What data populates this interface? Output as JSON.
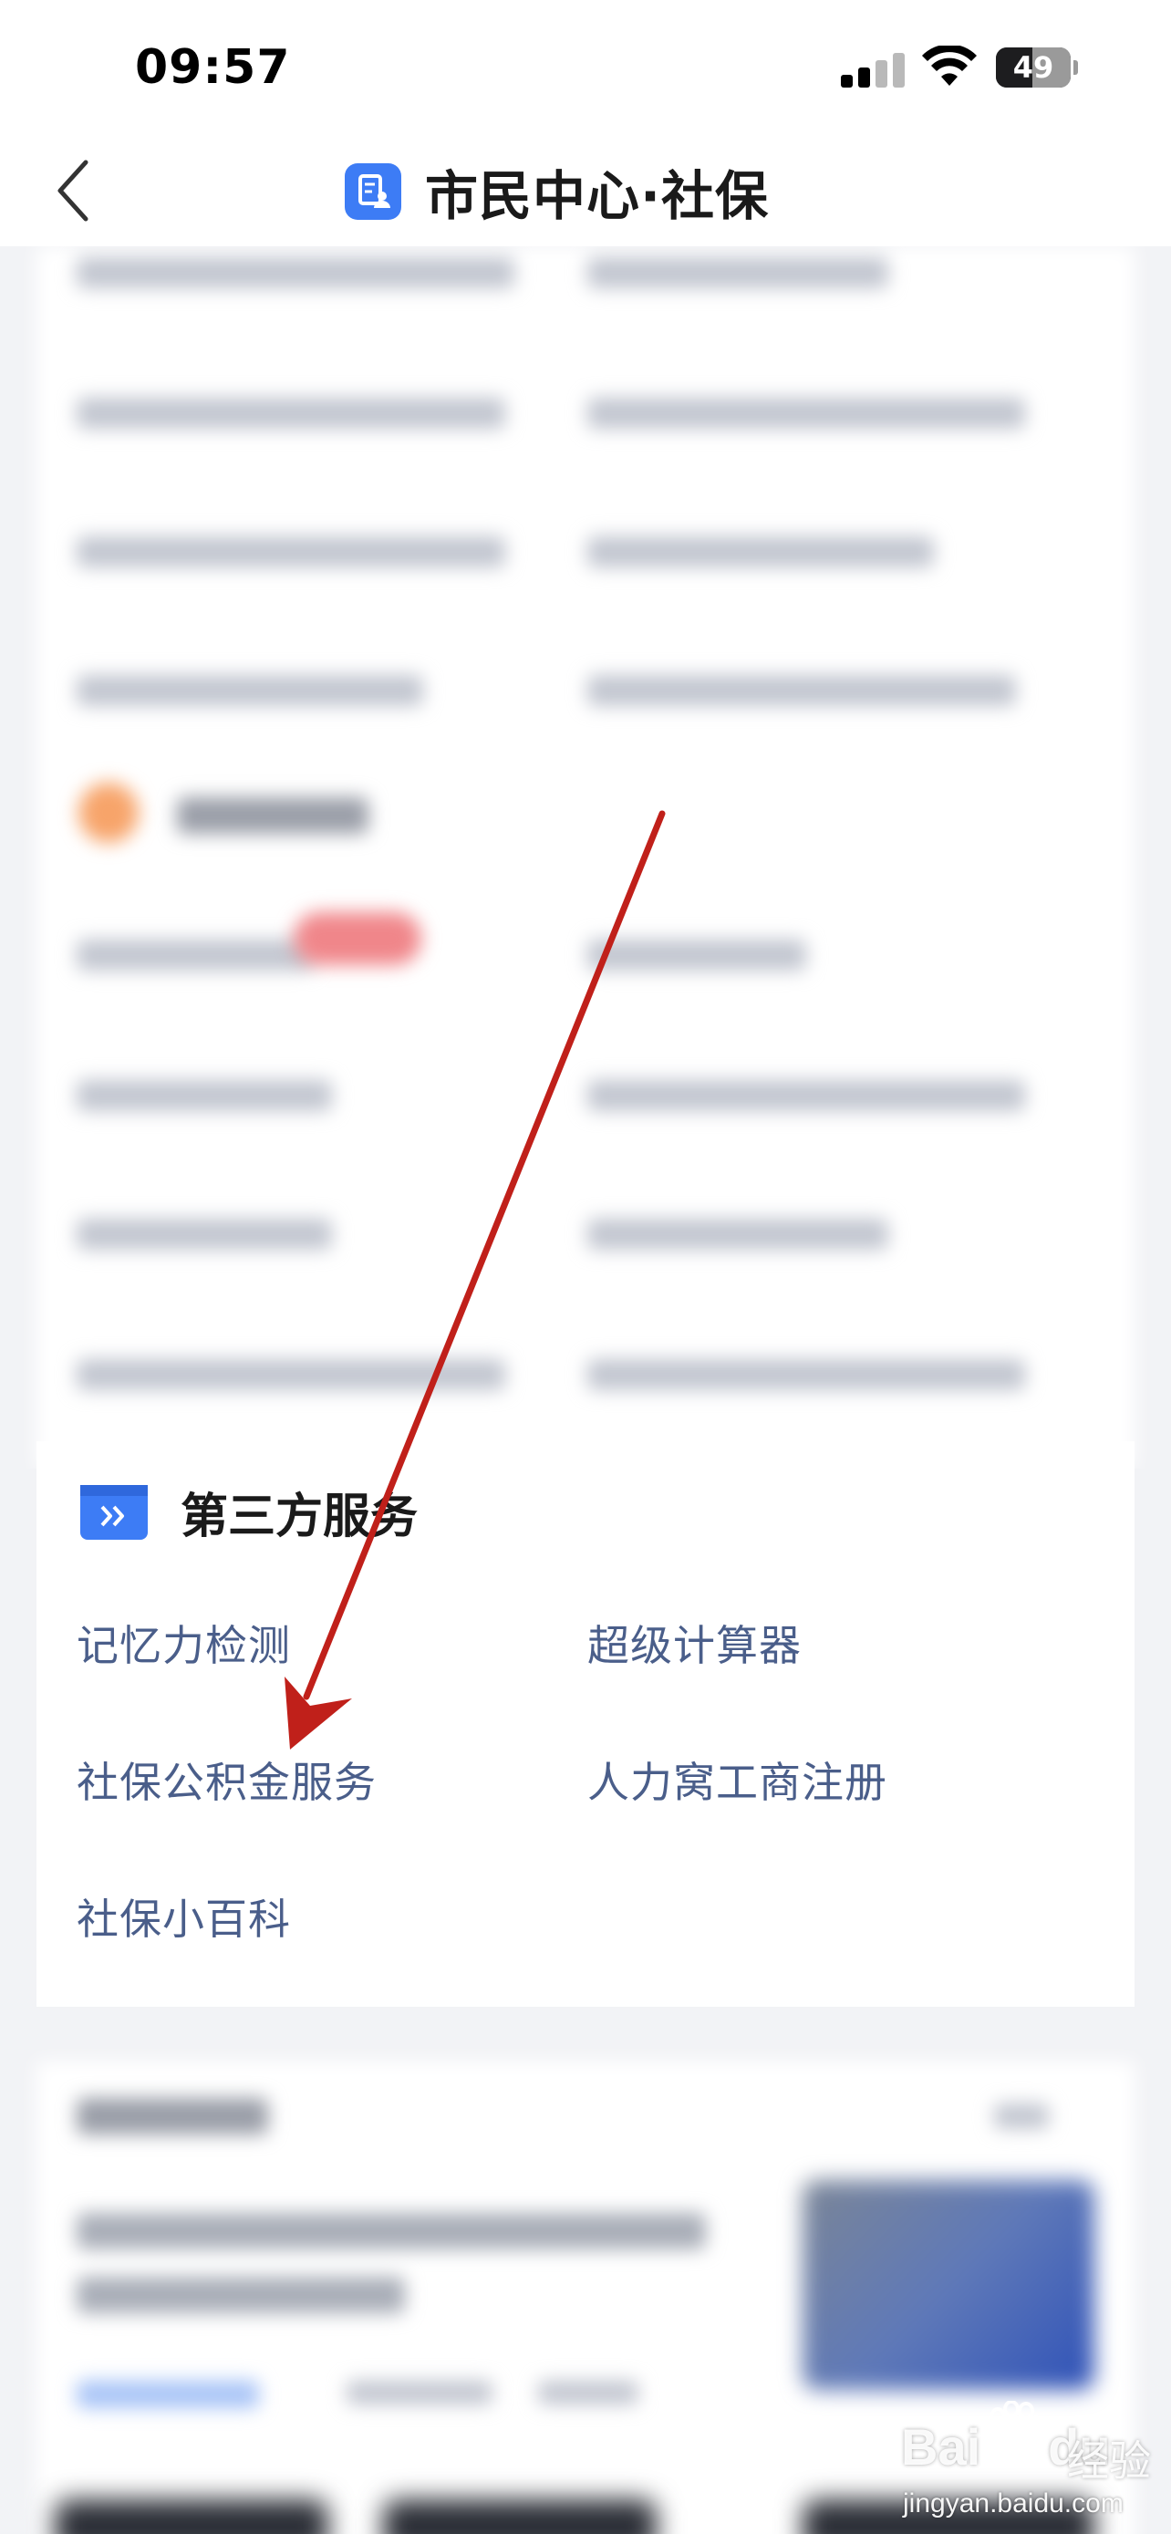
{
  "status_bar": {
    "time": "09:57",
    "battery_level": "49",
    "signal_bars": 2
  },
  "nav": {
    "title": "市民中心·社保",
    "back_icon": "chevron-left-icon",
    "title_icon": "document-person-icon"
  },
  "third_party": {
    "section_title": "第三方服务",
    "section_icon": "forward-double-arrow-icon",
    "items": [
      "记忆力检测",
      "超级计算器",
      "社保公积金服务",
      "人力窝工商注册",
      "社保小百科"
    ]
  },
  "watermark": {
    "logo": "Bai",
    "logo_tail": "du",
    "cn": "经验",
    "url": "jingyan.baidu.com"
  },
  "colors": {
    "accent": "#3d7cf5",
    "link": "#4a5e8a",
    "annotation": "#c0201a"
  }
}
